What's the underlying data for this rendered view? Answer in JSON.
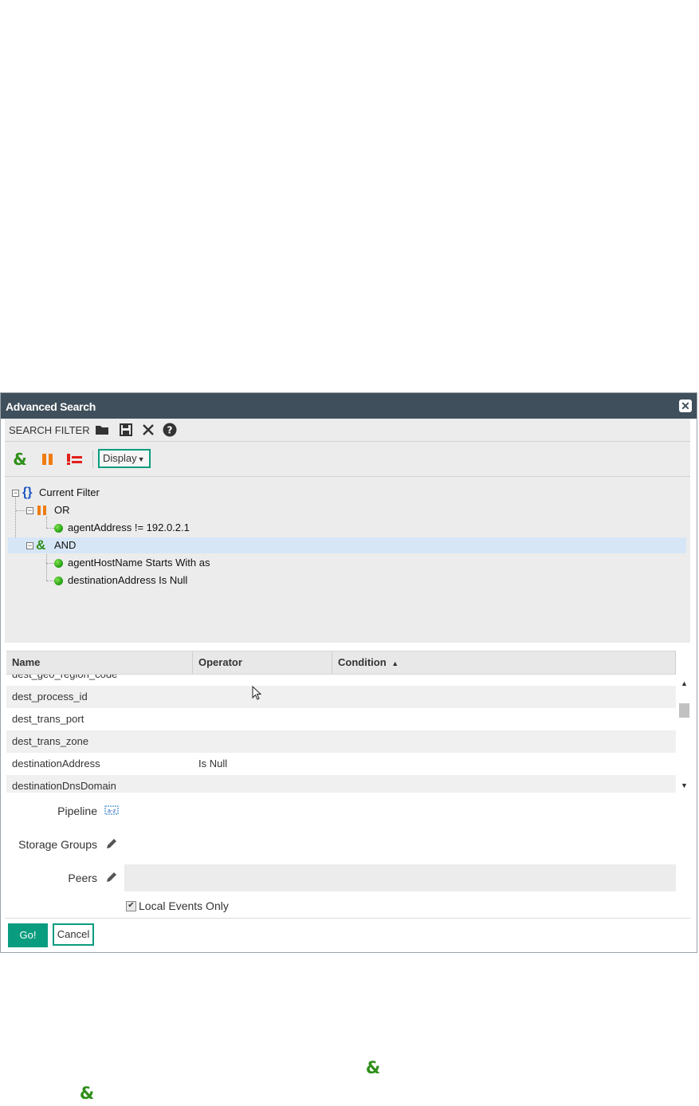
{
  "dialog": {
    "title": "Advanced Search"
  },
  "search_filter": {
    "label": "SEARCH FILTER",
    "icons": [
      "folder-icon",
      "save-icon",
      "clear-icon",
      "help-icon"
    ]
  },
  "toolbar": {
    "and_icon": "and-icon",
    "or_icon": "or-icon",
    "not_icon": "not-icon",
    "display_label": "Display"
  },
  "tree": {
    "root": "Current Filter",
    "or_label": "OR",
    "or_child": "agentAddress != 192.0.2.1",
    "and_label": "AND",
    "and_children": [
      "agentHostName Starts With as",
      "destinationAddress Is Null"
    ]
  },
  "grid": {
    "columns": {
      "name": "Name",
      "operator": "Operator",
      "condition": "Condition"
    },
    "rows": [
      {
        "name": "dest_geo_region_code",
        "operator": "",
        "condition": ""
      },
      {
        "name": "dest_process_id",
        "operator": "",
        "condition": ""
      },
      {
        "name": "dest_trans_port",
        "operator": "",
        "condition": ""
      },
      {
        "name": "dest_trans_zone",
        "operator": "",
        "condition": ""
      },
      {
        "name": "destinationAddress",
        "operator": "Is Null",
        "condition": ""
      },
      {
        "name": "destinationDnsDomain",
        "operator": "",
        "condition": ""
      }
    ]
  },
  "form": {
    "pipeline_label": "Pipeline",
    "storage_groups_label": "Storage Groups",
    "peers_label": "Peers",
    "local_events_label": "Local Events Only"
  },
  "buttons": {
    "go": "Go!",
    "cancel": "Cancel"
  },
  "colors": {
    "accent": "#0a9c7e",
    "titlebar": "#3f4f5b"
  }
}
